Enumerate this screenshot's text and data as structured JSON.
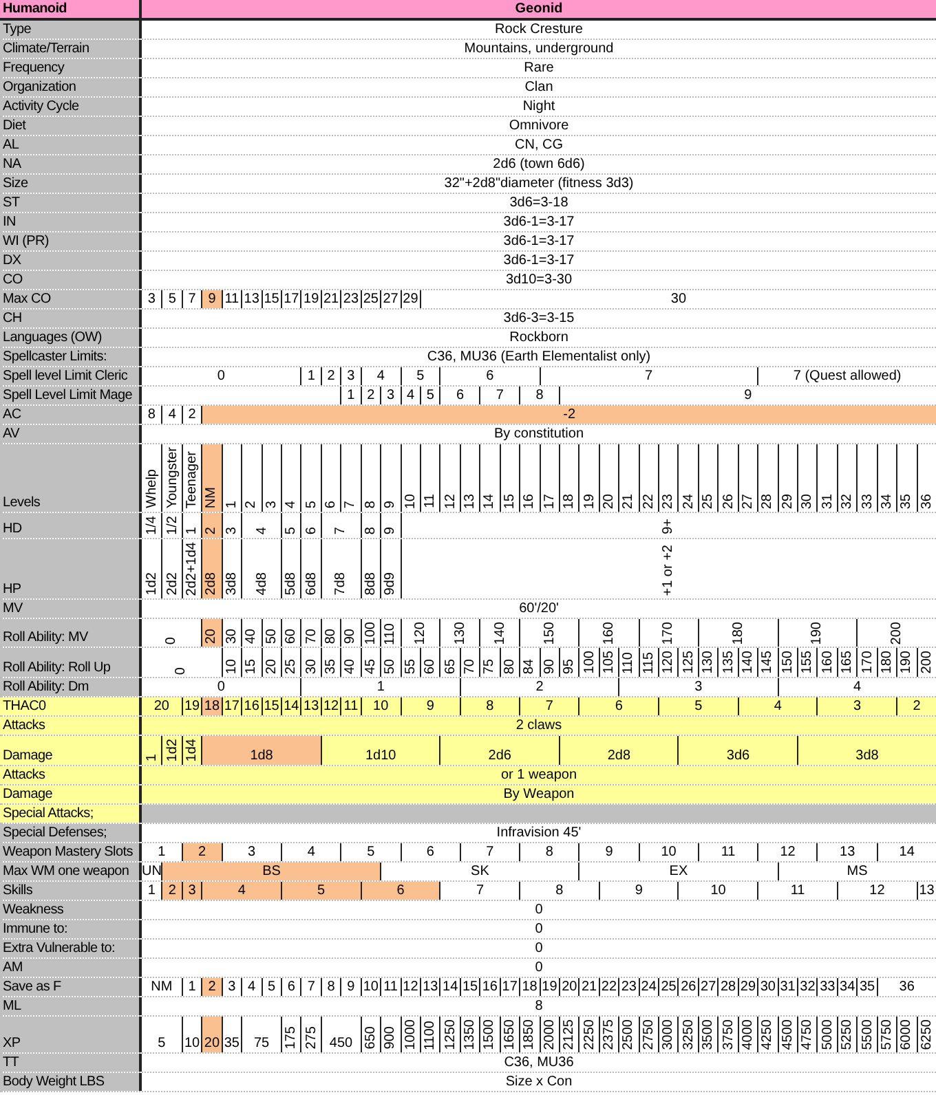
{
  "rows": [
    {
      "label": "Humanoid",
      "kind": "header",
      "value": "Geonid"
    },
    {
      "label": "Type",
      "kind": "plain",
      "value": "Rock Cresture"
    },
    {
      "label": "Climate/Terrain",
      "kind": "plain",
      "value": "Mountains, underground"
    },
    {
      "label": "Frequency",
      "kind": "plain",
      "value": "Rare"
    },
    {
      "label": "Organization",
      "kind": "plain",
      "value": "Clan"
    },
    {
      "label": "Activity Cycle",
      "kind": "plain",
      "value": "Night"
    },
    {
      "label": "Diet",
      "kind": "plain",
      "value": "Omnivore"
    },
    {
      "label": "AL",
      "kind": "plain",
      "value": "CN, CG"
    },
    {
      "label": "NA",
      "kind": "plain",
      "value": "2d6 (town 6d6)"
    },
    {
      "label": "Size",
      "kind": "plain",
      "value": "32\"+2d8\"diameter (fitness 3d3)"
    },
    {
      "label": "ST",
      "kind": "plain",
      "value": "3d6=3-18"
    },
    {
      "label": "IN",
      "kind": "plain",
      "value": "3d6-1=3-17"
    },
    {
      "label": "WI (PR)",
      "kind": "plain",
      "value": "3d6-1=3-17"
    },
    {
      "label": "DX",
      "kind": "plain",
      "value": "3d6-1=3-17"
    },
    {
      "label": "CO",
      "kind": "plain",
      "value": "3d10=3-30"
    },
    {
      "label": "Max CO",
      "kind": "plain",
      "cells": [
        {
          "text": "3",
          "highlighted": false
        },
        {
          "text": "5",
          "highlighted": false
        },
        {
          "text": "7",
          "highlighted": false
        },
        {
          "text": "9",
          "highlighted": true
        },
        {
          "text": "11",
          "highlighted": false
        },
        {
          "text": "13",
          "highlighted": false
        },
        {
          "text": "15",
          "highlighted": false
        },
        {
          "text": "17",
          "highlighted": false
        },
        {
          "text": "19",
          "highlighted": false
        },
        {
          "text": "21",
          "highlighted": false
        },
        {
          "text": "23",
          "highlighted": false
        },
        {
          "text": "25",
          "highlighted": false
        },
        {
          "text": "27",
          "highlighted": false
        },
        {
          "text": "29",
          "highlighted": false
        },
        {
          "text": "30",
          "colspan": 26,
          "highlighted": false
        }
      ]
    },
    {
      "label": "CH",
      "kind": "plain",
      "value": "3d6-3=3-15"
    },
    {
      "label": "Languages (OW)",
      "kind": "plain",
      "value": "Rockborn"
    },
    {
      "label": "Spellcaster Limits:",
      "kind": "plain",
      "value": "C36, MU36 (Earth Elementalist only)"
    },
    {
      "label": "Spell level Limit Cleric",
      "kind": "plain",
      "cells": [
        {
          "text": "0",
          "colspan": 8,
          "highlighted": false
        },
        {
          "text": "1",
          "highlighted": false
        },
        {
          "text": "2",
          "highlighted": false
        },
        {
          "text": "3",
          "highlighted": false
        },
        {
          "text": "4",
          "colspan": 2,
          "highlighted": false
        },
        {
          "text": "5",
          "colspan": 2,
          "highlighted": false
        },
        {
          "text": "6",
          "colspan": 5,
          "highlighted": false
        },
        {
          "text": "7",
          "colspan": 11,
          "highlighted": false
        },
        {
          "text": "7 (Quest allowed)",
          "colspan": 9,
          "highlighted": false
        }
      ]
    },
    {
      "label": "Spell Level Limit Mage",
      "kind": "plain",
      "cells": [
        {
          "colspan": 10
        },
        {
          "text": "1",
          "highlighted": false
        },
        {
          "text": "2",
          "highlighted": false
        },
        {
          "text": "3",
          "highlighted": false
        },
        {
          "text": "4",
          "highlighted": false
        },
        {
          "text": "5",
          "highlighted": false
        },
        {
          "text": "6",
          "colspan": 2,
          "highlighted": false
        },
        {
          "text": "7",
          "colspan": 2,
          "highlighted": false
        },
        {
          "text": "8",
          "colspan": 2,
          "highlighted": false
        },
        {
          "text": "9",
          "colspan": 19,
          "highlighted": false
        }
      ]
    },
    {
      "label": "AC",
      "kind": "plain",
      "cells": [
        {
          "text": "8",
          "highlighted": false
        },
        {
          "text": "4",
          "highlighted": false
        },
        {
          "text": "2",
          "highlighted": false
        },
        {
          "text": "-2",
          "colspan": 37,
          "highlighted": true
        }
      ]
    },
    {
      "label": "AV",
      "kind": "plain",
      "value": "By constitution"
    },
    {
      "label": "Levels",
      "kind": "plain",
      "cells": [
        {
          "text": "Whelp",
          "highlighted": false,
          "kind": "rotated"
        },
        {
          "text": "Youngster",
          "highlighted": false,
          "kind": "rotated"
        },
        {
          "text": "Teenager",
          "highlighted": false,
          "kind": "rotated"
        },
        {
          "text": "NM",
          "highlighted": true,
          "kind": "rotated"
        },
        {
          "text": "1",
          "highlighted": false,
          "kind": "rotated"
        },
        {
          "text": "2",
          "highlighted": false,
          "kind": "rotated"
        },
        {
          "text": "3",
          "highlighted": false,
          "kind": "rotated"
        },
        {
          "text": "4",
          "highlighted": false,
          "kind": "rotated"
        },
        {
          "text": "5",
          "highlighted": false,
          "kind": "rotated"
        },
        {
          "text": "6",
          "highlighted": false,
          "kind": "rotated"
        },
        {
          "text": "7",
          "highlighted": false,
          "kind": "rotated"
        },
        {
          "text": "8",
          "highlighted": false,
          "kind": "rotated"
        },
        {
          "text": "9",
          "highlighted": false,
          "kind": "rotated"
        },
        {
          "text": "10",
          "highlighted": false,
          "kind": "rotated"
        },
        {
          "text": "11",
          "highlighted": false,
          "kind": "rotated"
        },
        {
          "text": "12",
          "highlighted": false,
          "kind": "rotated"
        },
        {
          "text": "13",
          "highlighted": false,
          "kind": "rotated"
        },
        {
          "text": "14",
          "highlighted": false,
          "kind": "rotated"
        },
        {
          "text": "15",
          "highlighted": false,
          "kind": "rotated"
        },
        {
          "text": "16",
          "highlighted": false,
          "kind": "rotated"
        },
        {
          "text": "17",
          "highlighted": false,
          "kind": "rotated"
        },
        {
          "text": "18",
          "highlighted": false,
          "kind": "rotated"
        },
        {
          "text": "19",
          "highlighted": false,
          "kind": "rotated"
        },
        {
          "text": "20",
          "highlighted": false,
          "kind": "rotated"
        },
        {
          "text": "21",
          "highlighted": false,
          "kind": "rotated"
        },
        {
          "text": "22",
          "highlighted": false,
          "kind": "rotated"
        },
        {
          "text": "23",
          "highlighted": false,
          "kind": "rotated"
        },
        {
          "text": "24",
          "highlighted": false,
          "kind": "rotated"
        },
        {
          "text": "25",
          "highlighted": false,
          "kind": "rotated"
        },
        {
          "text": "26",
          "highlighted": false,
          "kind": "rotated"
        },
        {
          "text": "27",
          "highlighted": false,
          "kind": "rotated"
        },
        {
          "text": "28",
          "highlighted": false,
          "kind": "rotated"
        },
        {
          "text": "29",
          "highlighted": false,
          "kind": "rotated"
        },
        {
          "text": "30",
          "highlighted": false,
          "kind": "rotated"
        },
        {
          "text": "31",
          "highlighted": false,
          "kind": "rotated"
        },
        {
          "text": "32",
          "highlighted": false,
          "kind": "rotated"
        },
        {
          "text": "33",
          "highlighted": false,
          "kind": "rotated"
        },
        {
          "text": "34",
          "highlighted": false,
          "kind": "rotated"
        },
        {
          "text": "35",
          "highlighted": false,
          "kind": "rotated"
        },
        {
          "text": "36",
          "highlighted": false,
          "kind": "rotated"
        }
      ]
    },
    {
      "label": "HD",
      "kind": "plain",
      "cells": [
        {
          "text": "1/4",
          "highlighted": false,
          "kind": "rotated"
        },
        {
          "text": "1/2",
          "highlighted": false,
          "kind": "rotated"
        },
        {
          "text": "1",
          "highlighted": false,
          "kind": "rotated"
        },
        {
          "text": "2",
          "highlighted": true,
          "kind": "rotated"
        },
        {
          "text": "3",
          "highlighted": false,
          "kind": "rotated"
        },
        {
          "text": "4",
          "colspan": 2,
          "highlighted": false,
          "kind": "rotated"
        },
        {
          "text": "5",
          "highlighted": false,
          "kind": "rotated"
        },
        {
          "text": "6",
          "highlighted": false,
          "kind": "rotated"
        },
        {
          "text": "7",
          "colspan": 2,
          "highlighted": false,
          "kind": "rotated"
        },
        {
          "text": "8",
          "highlighted": false,
          "kind": "rotated"
        },
        {
          "text": "9",
          "highlighted": false,
          "kind": "rotated"
        },
        {
          "text": "9+",
          "colspan": 27,
          "highlighted": false,
          "kind": "rotated"
        }
      ]
    },
    {
      "label": "HP",
      "kind": "plain",
      "cells": [
        {
          "text": "1d2",
          "highlighted": false,
          "kind": "rotated"
        },
        {
          "text": "2d2",
          "highlighted": false,
          "kind": "rotated"
        },
        {
          "text": "2d2+1d4",
          "highlighted": false,
          "kind": "rotated"
        },
        {
          "text": "2d8",
          "highlighted": true,
          "kind": "rotated"
        },
        {
          "text": "3d8",
          "highlighted": false,
          "kind": "rotated"
        },
        {
          "text": "4d8",
          "colspan": 2,
          "highlighted": false,
          "kind": "rotated"
        },
        {
          "text": "5d8",
          "highlighted": false,
          "kind": "rotated"
        },
        {
          "text": "6d8",
          "highlighted": false,
          "kind": "rotated"
        },
        {
          "text": "7d8",
          "colspan": 2,
          "highlighted": false,
          "kind": "rotated"
        },
        {
          "text": "8d8",
          "highlighted": false,
          "kind": "rotated"
        },
        {
          "text": "9d9",
          "highlighted": false,
          "kind": "rotated"
        },
        {
          "text": "+1 or +2",
          "colspan": 27,
          "highlighted": false,
          "kind": "rotated"
        }
      ]
    },
    {
      "label": "MV",
      "kind": "plain",
      "value": "60'/20'"
    },
    {
      "label": "Roll Ability: MV",
      "kind": "plain",
      "cells": [
        {
          "text": "0",
          "colspan": 3,
          "highlighted": false,
          "kind": "rotated"
        },
        {
          "text": "20",
          "highlighted": true,
          "kind": "rotated"
        },
        {
          "text": "30",
          "highlighted": false,
          "kind": "rotated"
        },
        {
          "text": "40",
          "highlighted": false,
          "kind": "rotated"
        },
        {
          "text": "50",
          "highlighted": false,
          "kind": "rotated"
        },
        {
          "text": "60",
          "highlighted": false,
          "kind": "rotated"
        },
        {
          "text": "70",
          "highlighted": false,
          "kind": "rotated"
        },
        {
          "text": "80",
          "highlighted": false,
          "kind": "rotated"
        },
        {
          "text": "90",
          "highlighted": false,
          "kind": "rotated"
        },
        {
          "text": "100",
          "highlighted": false,
          "kind": "rotated"
        },
        {
          "text": "110",
          "highlighted": false,
          "kind": "rotated"
        },
        {
          "text": "120",
          "colspan": 2,
          "highlighted": false,
          "kind": "rotated"
        },
        {
          "text": "130",
          "colspan": 2,
          "highlighted": false,
          "kind": "rotated"
        },
        {
          "text": "140",
          "colspan": 2,
          "highlighted": false,
          "kind": "rotated"
        },
        {
          "text": "150",
          "colspan": 3,
          "highlighted": false,
          "kind": "rotated"
        },
        {
          "text": "160",
          "colspan": 3,
          "highlighted": false,
          "kind": "rotated"
        },
        {
          "text": "170",
          "colspan": 3,
          "highlighted": false,
          "kind": "rotated"
        },
        {
          "text": "180",
          "colspan": 4,
          "highlighted": false,
          "kind": "rotated"
        },
        {
          "text": "190",
          "colspan": 4,
          "highlighted": false,
          "kind": "rotated"
        },
        {
          "text": "200",
          "colspan": 4,
          "highlighted": false,
          "kind": "rotated"
        }
      ]
    },
    {
      "label": "Roll Ability: Roll Up",
      "kind": "plain",
      "cells": [
        {
          "text": "0",
          "colspan": 4,
          "highlighted": false,
          "kind": "rotated"
        },
        {
          "text": "10",
          "highlighted": false,
          "kind": "rotated"
        },
        {
          "text": "15",
          "highlighted": false,
          "kind": "rotated"
        },
        {
          "text": "20",
          "highlighted": false,
          "kind": "rotated"
        },
        {
          "text": "25",
          "highlighted": false,
          "kind": "rotated"
        },
        {
          "text": "30",
          "highlighted": false,
          "kind": "rotated"
        },
        {
          "text": "35",
          "highlighted": false,
          "kind": "rotated"
        },
        {
          "text": "40",
          "highlighted": false,
          "kind": "rotated"
        },
        {
          "text": "45",
          "highlighted": false,
          "kind": "rotated"
        },
        {
          "text": "50",
          "highlighted": false,
          "kind": "rotated"
        },
        {
          "text": "55",
          "highlighted": false,
          "kind": "rotated"
        },
        {
          "text": "60",
          "highlighted": false,
          "kind": "rotated"
        },
        {
          "text": "65",
          "highlighted": false,
          "kind": "rotated"
        },
        {
          "text": "70",
          "highlighted": false,
          "kind": "rotated"
        },
        {
          "text": "75",
          "highlighted": false,
          "kind": "rotated"
        },
        {
          "text": "80",
          "highlighted": false,
          "kind": "rotated"
        },
        {
          "text": "84",
          "highlighted": false,
          "kind": "rotated"
        },
        {
          "text": "90",
          "highlighted": false,
          "kind": "rotated"
        },
        {
          "text": "95",
          "highlighted": false,
          "kind": "rotated"
        },
        {
          "text": "100",
          "highlighted": false,
          "kind": "rotated"
        },
        {
          "text": "105",
          "highlighted": false,
          "kind": "rotated"
        },
        {
          "text": "110",
          "highlighted": false,
          "kind": "rotated"
        },
        {
          "text": "115",
          "highlighted": false,
          "kind": "rotated"
        },
        {
          "text": "120",
          "highlighted": false,
          "kind": "rotated"
        },
        {
          "text": "125",
          "highlighted": false,
          "kind": "rotated"
        },
        {
          "text": "130",
          "highlighted": false,
          "kind": "rotated"
        },
        {
          "text": "135",
          "highlighted": false,
          "kind": "rotated"
        },
        {
          "text": "140",
          "highlighted": false,
          "kind": "rotated"
        },
        {
          "text": "145",
          "highlighted": false,
          "kind": "rotated"
        },
        {
          "text": "150",
          "highlighted": false,
          "kind": "rotated"
        },
        {
          "text": "155",
          "highlighted": false,
          "kind": "rotated"
        },
        {
          "text": "160",
          "highlighted": false,
          "kind": "rotated"
        },
        {
          "text": "165",
          "highlighted": false,
          "kind": "rotated"
        },
        {
          "text": "170",
          "highlighted": false,
          "kind": "rotated"
        },
        {
          "text": "180",
          "highlighted": false,
          "kind": "rotated"
        },
        {
          "text": "190",
          "highlighted": false,
          "kind": "rotated"
        },
        {
          "text": "200",
          "highlighted": false,
          "kind": "rotated"
        }
      ]
    },
    {
      "label": "Roll Ability: Dm",
      "kind": "plain",
      "cells": [
        {
          "text": "0",
          "colspan": 8,
          "highlighted": false
        },
        {
          "text": "1",
          "colspan": 8,
          "highlighted": false
        },
        {
          "text": "2",
          "colspan": 8,
          "highlighted": false
        },
        {
          "text": "3",
          "colspan": 8,
          "highlighted": false
        },
        {
          "text": "4",
          "colspan": 8,
          "highlighted": false
        }
      ]
    },
    {
      "label": "THAC0",
      "kind": "yellow",
      "cells": [
        {
          "text": "20",
          "colspan": 2,
          "highlighted": false
        },
        {
          "text": "19",
          "highlighted": false
        },
        {
          "text": "18",
          "highlighted": true
        },
        {
          "text": "17",
          "highlighted": false
        },
        {
          "text": "16",
          "highlighted": false
        },
        {
          "text": "15",
          "highlighted": false
        },
        {
          "text": "14",
          "highlighted": false
        },
        {
          "text": "13",
          "highlighted": false
        },
        {
          "text": "12",
          "highlighted": false
        },
        {
          "text": "11",
          "highlighted": false
        },
        {
          "text": "10",
          "colspan": 2,
          "highlighted": false
        },
        {
          "text": "9",
          "colspan": 3,
          "highlighted": false
        },
        {
          "text": "8",
          "colspan": 3,
          "highlighted": false
        },
        {
          "text": "7",
          "colspan": 3,
          "highlighted": false
        },
        {
          "text": "6",
          "colspan": 4,
          "highlighted": false
        },
        {
          "text": "5",
          "colspan": 4,
          "highlighted": false
        },
        {
          "text": "4",
          "colspan": 4,
          "highlighted": false
        },
        {
          "text": "3",
          "colspan": 4,
          "highlighted": false
        },
        {
          "text": "2",
          "colspan": 2,
          "highlighted": false
        }
      ]
    },
    {
      "label": "Attacks",
      "kind": "yellow",
      "value": "2 claws"
    },
    {
      "label": "Damage",
      "kind": "yellow",
      "cells": [
        {
          "text": "1",
          "highlighted": false,
          "kind": "rotated"
        },
        {
          "text": "1d2",
          "highlighted": false,
          "kind": "rotated"
        },
        {
          "text": "1d4",
          "highlighted": false,
          "kind": "rotated"
        },
        {
          "text": "1d8",
          "colspan": 6,
          "highlighted": true,
          "kind": "plain"
        },
        {
          "text": "1d10",
          "colspan": 6,
          "highlighted": false,
          "kind": "plain"
        },
        {
          "text": "2d6",
          "colspan": 6,
          "highlighted": false,
          "kind": "plain"
        },
        {
          "text": "2d8",
          "colspan": 6,
          "highlighted": false,
          "kind": "plain"
        },
        {
          "text": "3d6",
          "colspan": 6,
          "highlighted": false,
          "kind": "plain"
        },
        {
          "text": "3d8",
          "colspan": 7,
          "highlighted": false,
          "kind": "plain"
        }
      ]
    },
    {
      "label": "Attacks",
      "kind": "yellow",
      "value": "or 1 weapon"
    },
    {
      "label": "Damage",
      "kind": "yellow",
      "value": "By Weapon"
    },
    {
      "label": "Special Attacks;",
      "kind": "blank"
    },
    {
      "label": "Special Defenses;",
      "kind": "plain",
      "value": "Infravision 45'"
    },
    {
      "label": "Weapon Mastery Slots",
      "kind": "plain",
      "cells": [
        {
          "text": "1",
          "colspan": 2,
          "highlighted": false
        },
        {
          "text": "2",
          "colspan": 2,
          "highlighted": true
        },
        {
          "text": "3",
          "colspan": 3,
          "highlighted": false
        },
        {
          "text": "4",
          "colspan": 3,
          "highlighted": false
        },
        {
          "text": "5",
          "colspan": 3,
          "highlighted": false
        },
        {
          "text": "6",
          "colspan": 3,
          "highlighted": false
        },
        {
          "text": "7",
          "colspan": 3,
          "highlighted": false
        },
        {
          "text": "8",
          "colspan": 3,
          "highlighted": false
        },
        {
          "text": "9",
          "colspan": 3,
          "highlighted": false
        },
        {
          "text": "10",
          "colspan": 3,
          "highlighted": false
        },
        {
          "text": "11",
          "colspan": 3,
          "highlighted": false
        },
        {
          "text": "12",
          "colspan": 3,
          "highlighted": false
        },
        {
          "text": "13",
          "colspan": 3,
          "highlighted": false
        },
        {
          "text": "14",
          "colspan": 3,
          "highlighted": false
        }
      ]
    },
    {
      "label": "Max WM one weapon",
      "kind": "plain",
      "cells": [
        {
          "text": "UN",
          "highlighted": false
        },
        {
          "text": "BS",
          "colspan": 11,
          "highlighted": true
        },
        {
          "text": "SK",
          "colspan": 10,
          "highlighted": false
        },
        {
          "text": "EX",
          "colspan": 10,
          "highlighted": false
        },
        {
          "text": "MS",
          "colspan": 8,
          "highlighted": false
        }
      ]
    },
    {
      "label": "Skills",
      "kind": "plain",
      "cells": [
        {
          "text": "1",
          "highlighted": false
        },
        {
          "text": "2",
          "highlighted": true
        },
        {
          "text": "3",
          "highlighted": true
        },
        {
          "text": "4",
          "colspan": 4,
          "highlighted": true
        },
        {
          "text": "5",
          "colspan": 4,
          "highlighted": true
        },
        {
          "text": "6",
          "colspan": 4,
          "highlighted": true
        },
        {
          "text": "7",
          "colspan": 4,
          "highlighted": false
        },
        {
          "text": "8",
          "colspan": 4,
          "highlighted": false
        },
        {
          "text": "9",
          "colspan": 4,
          "highlighted": false
        },
        {
          "text": "10",
          "colspan": 4,
          "highlighted": false
        },
        {
          "text": "11",
          "colspan": 4,
          "highlighted": false
        },
        {
          "text": "12",
          "colspan": 4,
          "highlighted": false
        },
        {
          "text": "13",
          "highlighted": false
        }
      ]
    },
    {
      "label": "Weakness",
      "kind": "plain",
      "value": "0"
    },
    {
      "label": "Immune to:",
      "kind": "plain",
      "value": "0"
    },
    {
      "label": "Extra Vulnerable to:",
      "kind": "plain",
      "value": "0"
    },
    {
      "label": "AM",
      "kind": "plain",
      "value": "0"
    },
    {
      "label": "Save as F",
      "kind": "plain",
      "cells": [
        {
          "text": "NM",
          "colspan": 2,
          "highlighted": false
        },
        {
          "text": "1",
          "highlighted": false
        },
        {
          "text": "2",
          "highlighted": true
        },
        {
          "text": "3",
          "highlighted": false
        },
        {
          "text": "4",
          "highlighted": false
        },
        {
          "text": "5",
          "highlighted": false
        },
        {
          "text": "6",
          "highlighted": false
        },
        {
          "text": "7",
          "highlighted": false
        },
        {
          "text": "8",
          "highlighted": false
        },
        {
          "text": "9",
          "highlighted": false
        },
        {
          "text": "10",
          "highlighted": false
        },
        {
          "text": "11",
          "highlighted": false
        },
        {
          "text": "12",
          "highlighted": false
        },
        {
          "text": "13",
          "highlighted": false
        },
        {
          "text": "14",
          "highlighted": false
        },
        {
          "text": "15",
          "highlighted": false
        },
        {
          "text": "16",
          "highlighted": false
        },
        {
          "text": "17",
          "highlighted": false
        },
        {
          "text": "18",
          "highlighted": false
        },
        {
          "text": "19",
          "highlighted": false
        },
        {
          "text": "20",
          "highlighted": false
        },
        {
          "text": "21",
          "highlighted": false
        },
        {
          "text": "22",
          "highlighted": false
        },
        {
          "text": "23",
          "highlighted": false
        },
        {
          "text": "24",
          "highlighted": false
        },
        {
          "text": "25",
          "highlighted": false
        },
        {
          "text": "26",
          "highlighted": false
        },
        {
          "text": "27",
          "highlighted": false
        },
        {
          "text": "28",
          "highlighted": false
        },
        {
          "text": "29",
          "highlighted": false
        },
        {
          "text": "30",
          "highlighted": false
        },
        {
          "text": "31",
          "highlighted": false
        },
        {
          "text": "32",
          "highlighted": false
        },
        {
          "text": "33",
          "highlighted": false
        },
        {
          "text": "34",
          "highlighted": false
        },
        {
          "text": "35",
          "highlighted": false
        },
        {
          "text": "36",
          "colspan": 3,
          "highlighted": false
        }
      ]
    },
    {
      "label": "ML",
      "kind": "plain",
      "value": "8"
    },
    {
      "label": "XP",
      "kind": "plain",
      "cells": [
        {
          "text": "5",
          "colspan": 2,
          "highlighted": false,
          "kind": "plain"
        },
        {
          "text": "10",
          "highlighted": false,
          "kind": "plain"
        },
        {
          "text": "20",
          "highlighted": true,
          "kind": "plain"
        },
        {
          "text": "35",
          "highlighted": false,
          "kind": "plain"
        },
        {
          "text": "75",
          "colspan": 2,
          "highlighted": false,
          "kind": "plain"
        },
        {
          "text": "175",
          "highlighted": false,
          "kind": "rotated"
        },
        {
          "text": "275",
          "highlighted": false,
          "kind": "rotated"
        },
        {
          "text": "450",
          "colspan": 2,
          "highlighted": false,
          "kind": "plain"
        },
        {
          "text": "650",
          "highlighted": false,
          "kind": "rotated"
        },
        {
          "text": "900",
          "highlighted": false,
          "kind": "rotated"
        },
        {
          "text": "1000",
          "highlighted": false,
          "kind": "rotated"
        },
        {
          "text": "1100",
          "highlighted": false,
          "kind": "rotated"
        },
        {
          "text": "1250",
          "highlighted": false,
          "kind": "rotated"
        },
        {
          "text": "1350",
          "highlighted": false,
          "kind": "rotated"
        },
        {
          "text": "1500",
          "highlighted": false,
          "kind": "rotated"
        },
        {
          "text": "1650",
          "highlighted": false,
          "kind": "rotated"
        },
        {
          "text": "1850",
          "highlighted": false,
          "kind": "rotated"
        },
        {
          "text": "2000",
          "highlighted": false,
          "kind": "rotated"
        },
        {
          "text": "2125",
          "highlighted": false,
          "kind": "rotated"
        },
        {
          "text": "2250",
          "highlighted": false,
          "kind": "rotated"
        },
        {
          "text": "2375",
          "highlighted": false,
          "kind": "rotated"
        },
        {
          "text": "2500",
          "highlighted": false,
          "kind": "rotated"
        },
        {
          "text": "2750",
          "highlighted": false,
          "kind": "rotated"
        },
        {
          "text": "3000",
          "highlighted": false,
          "kind": "rotated"
        },
        {
          "text": "3250",
          "highlighted": false,
          "kind": "rotated"
        },
        {
          "text": "3500",
          "highlighted": false,
          "kind": "rotated"
        },
        {
          "text": "3750",
          "highlighted": false,
          "kind": "rotated"
        },
        {
          "text": "4000",
          "highlighted": false,
          "kind": "rotated"
        },
        {
          "text": "4250",
          "highlighted": false,
          "kind": "rotated"
        },
        {
          "text": "4500",
          "highlighted": false,
          "kind": "rotated"
        },
        {
          "text": "4750",
          "highlighted": false,
          "kind": "rotated"
        },
        {
          "text": "5000",
          "highlighted": false,
          "kind": "rotated"
        },
        {
          "text": "5250",
          "highlighted": false,
          "kind": "rotated"
        },
        {
          "text": "5500",
          "highlighted": false,
          "kind": "rotated"
        },
        {
          "text": "5750",
          "highlighted": false,
          "kind": "rotated"
        },
        {
          "text": "6000",
          "highlighted": false,
          "kind": "rotated"
        },
        {
          "text": "6250",
          "highlighted": false,
          "kind": "rotated"
        }
      ]
    },
    {
      "label": "TT",
      "kind": "plain",
      "value": "C36, MU36"
    },
    {
      "label": "Body Weight LBS",
      "kind": "plain",
      "value": "Size x Con"
    }
  ]
}
